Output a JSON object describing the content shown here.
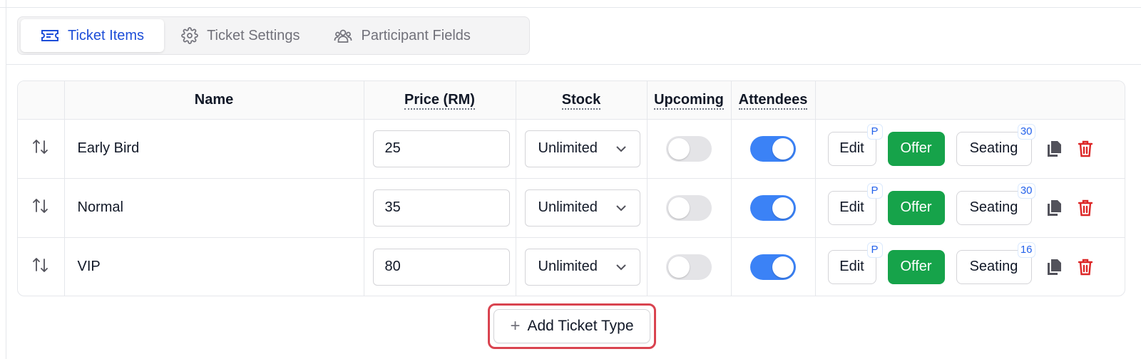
{
  "tabs": [
    {
      "label": "Ticket Items",
      "icon": "ticket-icon",
      "active": true
    },
    {
      "label": "Ticket Settings",
      "icon": "gear-icon",
      "active": false
    },
    {
      "label": "Participant Fields",
      "icon": "users-icon",
      "active": false
    }
  ],
  "table": {
    "headers": {
      "name": "Name",
      "price": "Price (RM)",
      "stock": "Stock",
      "upcoming": "Upcoming",
      "attendees": "Attendees"
    },
    "rows": [
      {
        "name": "Early Bird",
        "price": "25",
        "stock": "Unlimited",
        "upcoming": false,
        "attendees": true,
        "edit_label": "Edit",
        "edit_badge": "P",
        "offer_label": "Offer",
        "seating_label": "Seating",
        "seating_badge": "30"
      },
      {
        "name": "Normal",
        "price": "35",
        "stock": "Unlimited",
        "upcoming": false,
        "attendees": true,
        "edit_label": "Edit",
        "edit_badge": "P",
        "offer_label": "Offer",
        "seating_label": "Seating",
        "seating_badge": "30"
      },
      {
        "name": "VIP",
        "price": "80",
        "stock": "Unlimited",
        "upcoming": false,
        "attendees": true,
        "edit_label": "Edit",
        "edit_badge": "P",
        "offer_label": "Offer",
        "seating_label": "Seating",
        "seating_badge": "16"
      }
    ]
  },
  "add_button": {
    "label": "Add Ticket Type",
    "icon": "plus-icon"
  },
  "colors": {
    "accent_blue": "#1d4ed8",
    "toggle_on": "#3b82f6",
    "offer_green": "#16a34a",
    "delete_red": "#dc2626",
    "highlight_red": "#d9434f"
  }
}
